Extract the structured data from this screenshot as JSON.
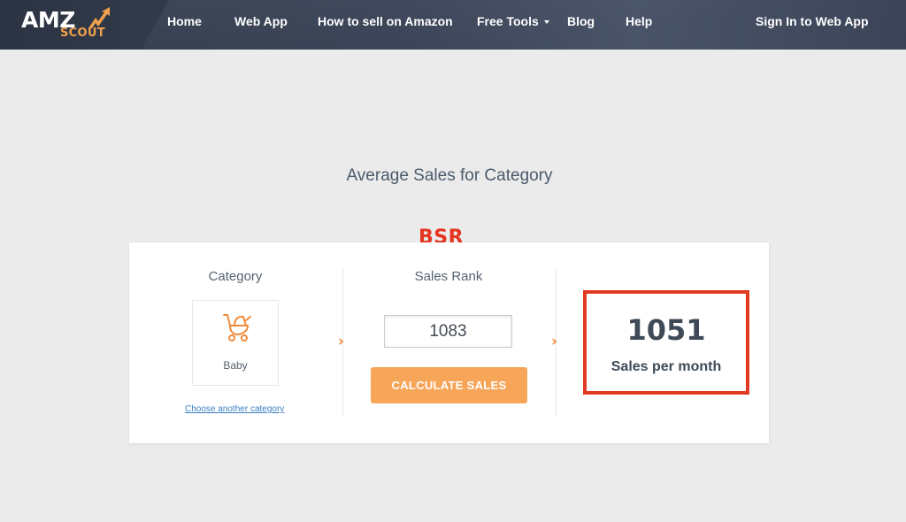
{
  "logo": {
    "primary": "AMZ",
    "secondary": "SCOUT"
  },
  "nav": {
    "items": [
      {
        "label": "Home"
      },
      {
        "label": "Web App"
      },
      {
        "label": "How to sell on Amazon"
      },
      {
        "label": "Free Tools"
      },
      {
        "label": "Blog"
      },
      {
        "label": "Help"
      }
    ],
    "sign_in": "Sign In to Web App"
  },
  "page_title": "Average Sales for Category",
  "annotation": {
    "label": "BSR",
    "color": "#e4361f"
  },
  "calculator": {
    "category": {
      "label": "Category",
      "selected": "Baby",
      "icon": "stroller-icon",
      "change_link": "Choose another category"
    },
    "sales_rank": {
      "label": "Sales Rank",
      "value": "1083",
      "button_label": "CALCULATE SALES"
    },
    "result": {
      "value": "1051",
      "label": "Sales per month",
      "highlight_color": "#e23a22"
    }
  },
  "colors": {
    "accent": "#f6a559",
    "nav_bg": "#2f3747",
    "link": "#3a7fc1"
  }
}
